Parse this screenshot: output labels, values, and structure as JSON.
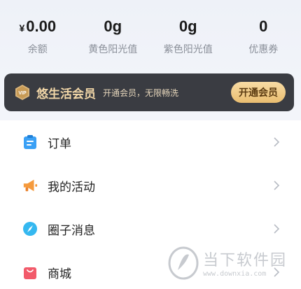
{
  "stats": [
    {
      "value": "0.00",
      "prefix": "¥",
      "label": "余额"
    },
    {
      "value": "0g",
      "prefix": "",
      "label": "黄色阳光值"
    },
    {
      "value": "0g",
      "prefix": "",
      "label": "紫色阳光值"
    },
    {
      "value": "0",
      "prefix": "",
      "label": "优惠券"
    }
  ],
  "vip": {
    "badge": "VIP",
    "title": "悠生活会员",
    "desc": "开通会员，无限畅洗",
    "button": "开通会员",
    "accent": "#f2d7a8",
    "background": "#3a3c42"
  },
  "menu": [
    {
      "label": "订单",
      "icon": "clipboard-icon",
      "color": "#3aa0f5"
    },
    {
      "label": "我的活动",
      "icon": "megaphone-icon",
      "color": "#f59a3c"
    },
    {
      "label": "圈子消息",
      "icon": "compass-icon",
      "color": "#35b8f0"
    },
    {
      "label": "商城",
      "icon": "shopping-bag-icon",
      "color": "#f25a6a"
    }
  ],
  "watermark": {
    "title": "当下软件园",
    "url": "www.downxia.com"
  }
}
